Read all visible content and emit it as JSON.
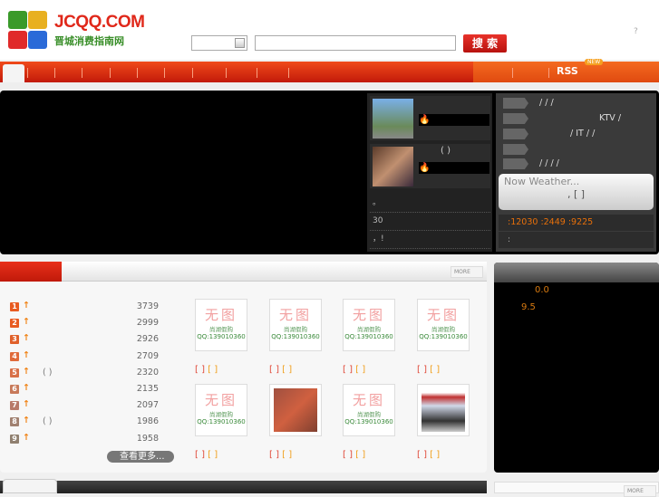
{
  "header": {
    "brand": "JCQQ.COM",
    "subtitle": "晋城消费指南网",
    "search_label": "搜 索",
    "help": "?",
    "search_placeholder": ""
  },
  "nav": {
    "rss": "RSS",
    "new_badge": "NEW"
  },
  "featured": {
    "item2_title": "( )",
    "lines": [
      "。",
      "30",
      "，!"
    ]
  },
  "tags": {
    "row1": "/        /        /",
    "row2": "KTV  /",
    "row3": "/        IT   /    /",
    "row4": "",
    "row5": "/    /        /    /"
  },
  "weather": {
    "title": "Now Weather...",
    "detail": ",   [ ]"
  },
  "stats": {
    "text": ":12030  :2449  :9225",
    "line2": ":"
  },
  "ranking": {
    "items": [
      {
        "rank": "1",
        "name": "",
        "count": "3739"
      },
      {
        "rank": "2",
        "name": "",
        "count": "2999"
      },
      {
        "rank": "3",
        "name": "",
        "count": "2926"
      },
      {
        "rank": "4",
        "name": "",
        "count": "2709"
      },
      {
        "rank": "5",
        "name": "( )",
        "count": "2320"
      },
      {
        "rank": "6",
        "name": "",
        "count": "2135"
      },
      {
        "rank": "7",
        "name": "",
        "count": "2097"
      },
      {
        "rank": "8",
        "name": "( )",
        "count": "1986"
      },
      {
        "rank": "9",
        "name": "",
        "count": "1958"
      }
    ],
    "more": "查看更多..."
  },
  "cards": {
    "no_image": "无图",
    "sub": "尚湖假购",
    "qq": "QQ:139010360",
    "bracket1": "[ ]",
    "bracket2": "[ ]"
  },
  "more_label": "MORE",
  "scores": {
    "a": "0.0",
    "b": "9.5"
  }
}
